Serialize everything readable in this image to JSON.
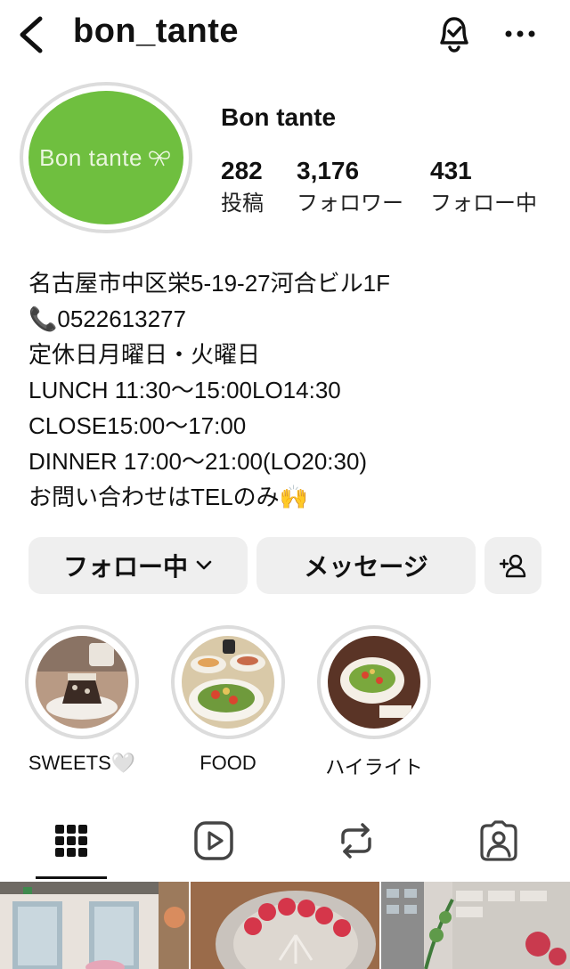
{
  "header": {
    "username": "bon_tante"
  },
  "profile": {
    "avatar_text": "Bon tante",
    "display_name": "Bon tante",
    "stats": {
      "posts": {
        "value": "282",
        "label": "投稿"
      },
      "followers": {
        "value": "3,176",
        "label": "フォロワー"
      },
      "following": {
        "value": "431",
        "label": "フォロー中"
      }
    },
    "bio": {
      "address": "名古屋市中区栄5-19-27河合ビル1F",
      "phone": "0522613277",
      "closed": "定休日月曜日・火曜日",
      "lunch": "LUNCH 11:30～15:00LO14:30",
      "close": "CLOSE15:00～17:00",
      "dinner": "DINNER 17:00～21:00(LO20:30)",
      "contact": "お問い合わせはTELのみ"
    }
  },
  "actions": {
    "following_label": "フォロー中",
    "message_label": "メッセージ"
  },
  "highlights": [
    {
      "label": "SWEETS🤍"
    },
    {
      "label": "FOOD"
    },
    {
      "label": "ハイライト"
    }
  ],
  "tabs": [
    "grid-icon",
    "reels-icon",
    "reposts-icon",
    "tagged-icon"
  ],
  "colors": {
    "avatar_green": "#6fbf3f",
    "button_bg": "#efefef",
    "ring": "#dcdcdc"
  }
}
